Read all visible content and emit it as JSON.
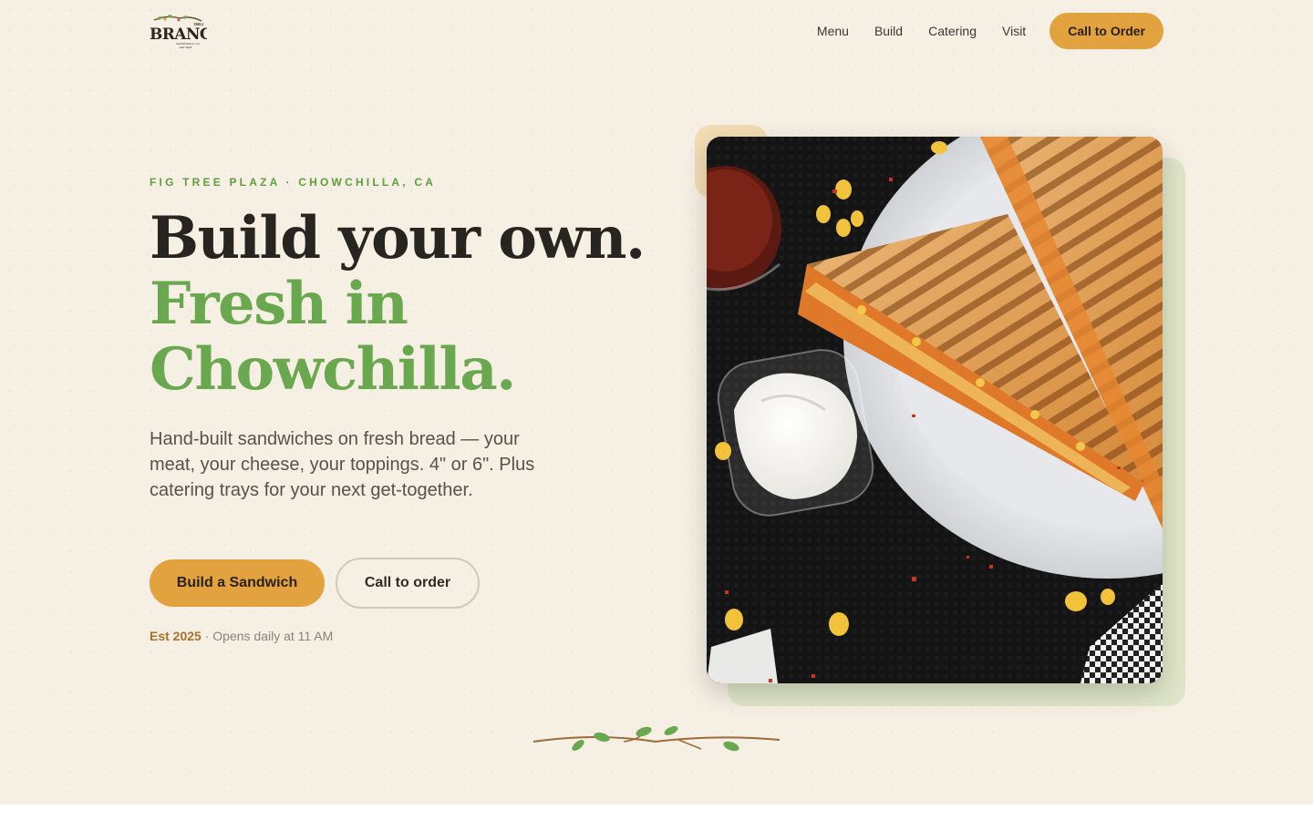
{
  "brand": {
    "logo_small": "DELI",
    "logo_name": "BRANCH",
    "logo_line1": "CHOWCHILLA, CA",
    "logo_line2": "EST 2025"
  },
  "nav": {
    "items": [
      "Menu",
      "Build",
      "Catering",
      "Visit"
    ],
    "cta": "Call to Order"
  },
  "hero": {
    "eyebrow": "FIG TREE PLAZA · CHOWCHILLA, CA",
    "headline_line1": "Build your own.",
    "headline_line2": "Fresh in",
    "headline_line3": "Chowchilla.",
    "subtext": "Hand-built sandwiches on fresh bread — your meat, your cheese, your toppings. 4\" or 6\". Plus catering trays for your next get-together.",
    "primary_button": "Build a Sandwich",
    "secondary_button": "Call to order",
    "meta_est": "Est 2025",
    "meta_hours": "· Opens daily at 11 AM"
  },
  "icons": {
    "vine": "vine-divider-icon",
    "photo": "grilled-sandwich-photo"
  },
  "colors": {
    "background": "#f6efe3",
    "accent_gold": "#e2a23e",
    "accent_green": "#6aa84f",
    "eyebrow_green": "#5e9e3c",
    "text_dark": "#28241f"
  }
}
